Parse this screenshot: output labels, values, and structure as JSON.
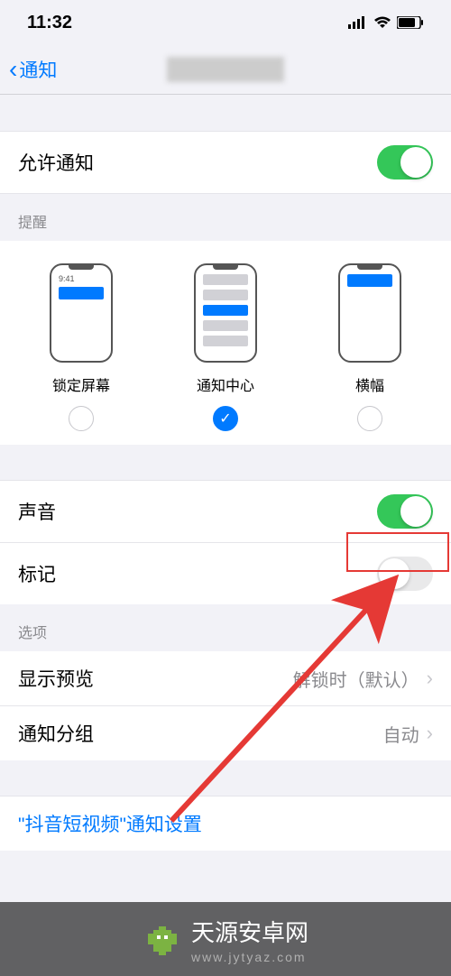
{
  "status": {
    "time": "11:32"
  },
  "nav": {
    "back_label": "通知"
  },
  "allow_notifications": {
    "label": "允许通知",
    "on": true
  },
  "alerts": {
    "header": "提醒",
    "lock_time": "9:41",
    "options": [
      {
        "label": "锁定屏幕",
        "checked": false
      },
      {
        "label": "通知中心",
        "checked": true
      },
      {
        "label": "横幅",
        "checked": false
      }
    ]
  },
  "sounds": {
    "label": "声音",
    "on": true
  },
  "badges": {
    "label": "标记",
    "on": false
  },
  "options": {
    "header": "选项",
    "preview": {
      "label": "显示预览",
      "value": "解锁时（默认）"
    },
    "grouping": {
      "label": "通知分组",
      "value": "自动"
    }
  },
  "app_settings": {
    "label": "\"抖音短视频\"通知设置"
  },
  "watermark": {
    "main": "天源安卓网",
    "sub": "www.jytyaz.com"
  }
}
